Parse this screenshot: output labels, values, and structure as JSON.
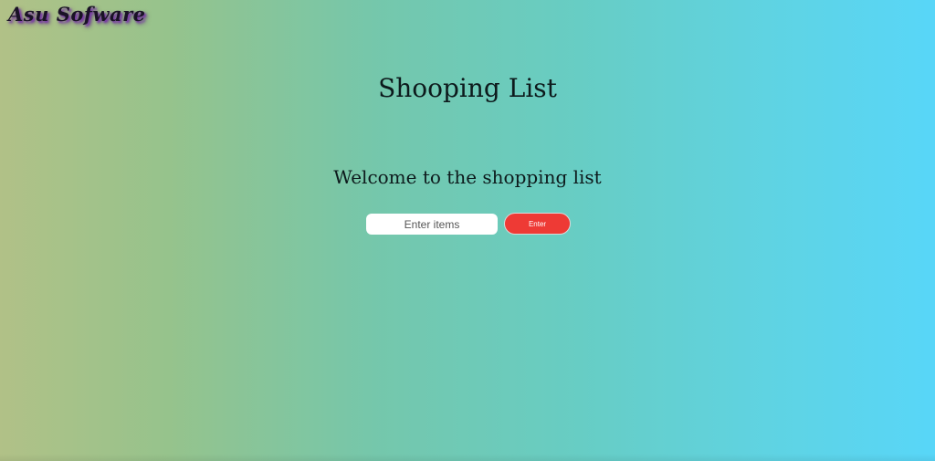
{
  "brand": {
    "logo_text": "Asu Sofware"
  },
  "main": {
    "title": "Shooping List",
    "welcome": "Welcome to the shopping list",
    "input": {
      "placeholder": "Enter items",
      "value": ""
    },
    "enter_button_label": "Enter"
  },
  "colors": {
    "gradient_start": "#b1c187",
    "gradient_end": "#58d6f8",
    "button": "#ee3a35",
    "logo_shadow": "#7a3aa8"
  }
}
